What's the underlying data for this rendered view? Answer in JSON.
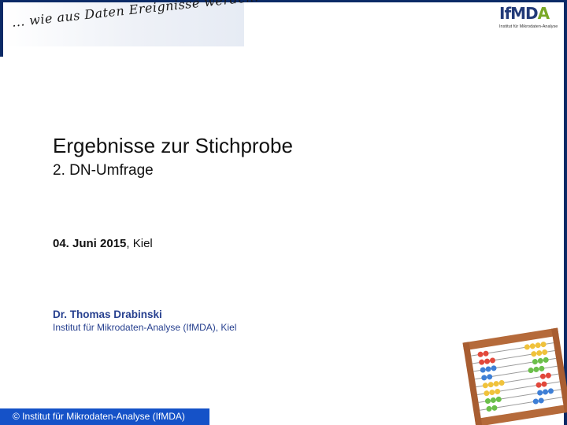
{
  "header": {
    "tagline": "... wie aus Daten Ereignisse werden.",
    "logo": {
      "text_main": "IfMD",
      "text_accent": "A",
      "subtitle": "Institut für Mikrodaten-Analyse"
    }
  },
  "slide": {
    "title": "Ergebnisse zur Stichprobe",
    "subtitle": "2. DN-Umfrage",
    "date": "04. Juni 2015",
    "place": ", Kiel",
    "author": "Dr. Thomas Drabinski",
    "affiliation": "Institut für Mikrodaten-Analyse (IfMDA), Kiel"
  },
  "footer": {
    "copyright": "© Institut für Mikrodaten-Analyse (IfMDA)"
  },
  "decoration": {
    "image": "abacus-image",
    "colors": {
      "frame": "#0b2a66",
      "footer": "#1552c8",
      "author_text": "#27408f",
      "logo_blue": "#223a78",
      "logo_green": "#79a825"
    }
  }
}
